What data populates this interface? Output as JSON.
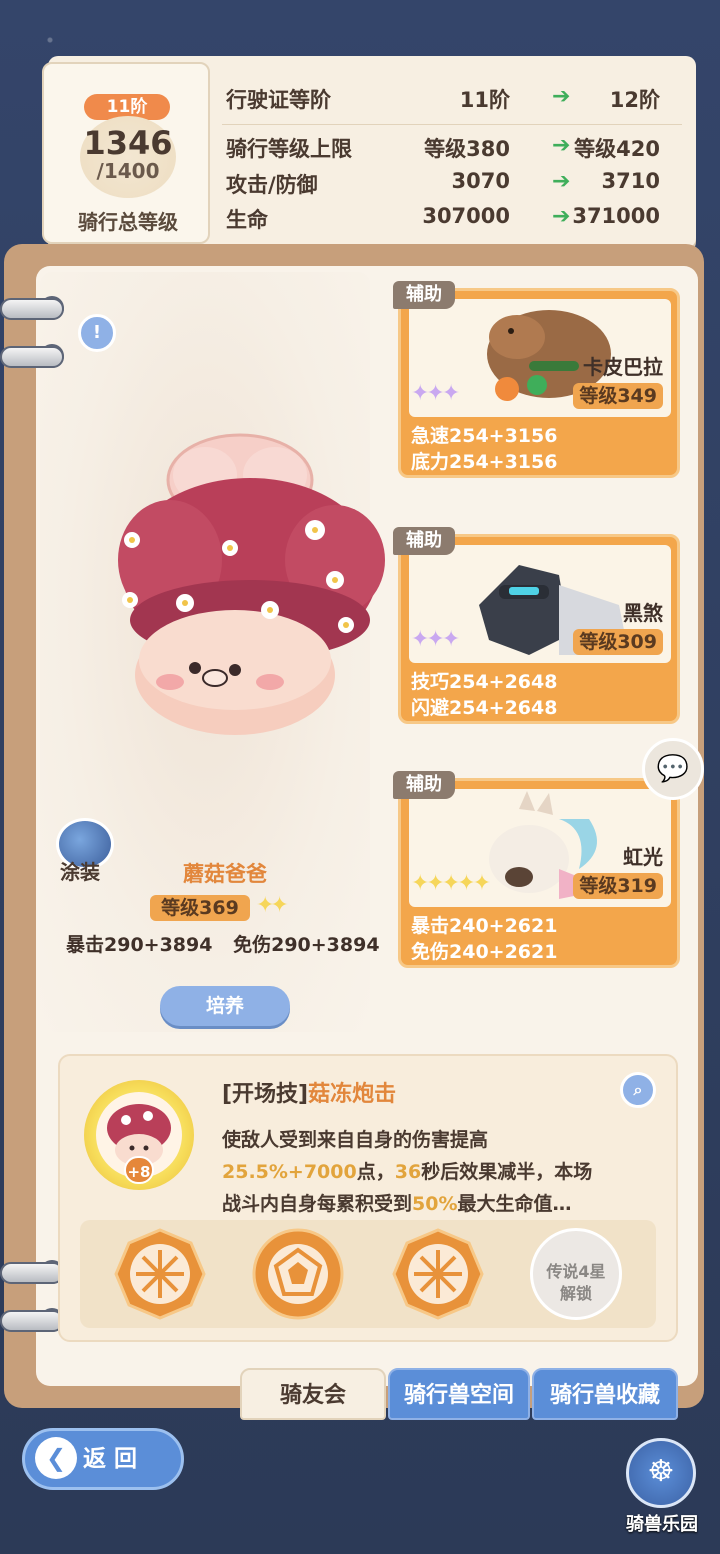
{
  "ride_level": {
    "tier_badge": "11阶",
    "total_level": "1346",
    "max_level": "/1400",
    "caption": "骑行总等级"
  },
  "stats": [
    {
      "label": "行驶证等阶",
      "current": "11阶",
      "next": "12阶"
    },
    {
      "label": "骑行等级上限",
      "current": "等级380",
      "next": "等级420"
    },
    {
      "label": "攻击/防御",
      "current": "3070",
      "next": "3710"
    },
    {
      "label": "生命",
      "current": "307000",
      "next": "371000"
    }
  ],
  "mount": {
    "name": "蘑菇爸爸",
    "level": "等级369",
    "stars": "✦✦",
    "stat1": "暴击290+3894",
    "stat2": "免伤290+3894",
    "skin_label": "涂装",
    "train_label": "培养"
  },
  "helpers": [
    {
      "tag": "辅助",
      "name": "卡皮巴拉",
      "level": "等级349",
      "stars": "✦✦✦",
      "stat1": "急速254+3156",
      "stat2": "底力254+3156"
    },
    {
      "tag": "辅助",
      "name": "黑煞",
      "level": "等级309",
      "stars": "✦✦✦",
      "stat1": "技巧254+2648",
      "stat2": "闪避254+2648"
    },
    {
      "tag": "辅助",
      "name": "虹光",
      "level": "等级319",
      "stars": "✦✦✦✦✦",
      "stat1": "暴击240+2621",
      "stat2": "免伤240+2621"
    }
  ],
  "skill": {
    "type": "[开场技]",
    "name": "菇冻炮击",
    "plus": "+8",
    "line1": "使敌人受到来自自身的伤害提高",
    "line2_a": "25.5%+7000",
    "line2_b": "点，",
    "line2_c": "36",
    "line2_d": "秒后效果减半，本场",
    "line3_a": "战斗内自身每累积受到",
    "line3_b": "50%",
    "line3_c": "最大生命值…",
    "locked_label_1": "传说4星",
    "locked_label_2": "解锁"
  },
  "tabs": {
    "active": "骑友会",
    "tab2": "骑行兽空间",
    "tab3": "骑行兽收藏"
  },
  "footer": {
    "back_label": "返 回",
    "park_label": "骑兽乐园"
  },
  "colors": {
    "accent_orange": "#f3a64b",
    "accent_blue": "#5b8ed8",
    "arrow_green": "#3fae5a"
  }
}
